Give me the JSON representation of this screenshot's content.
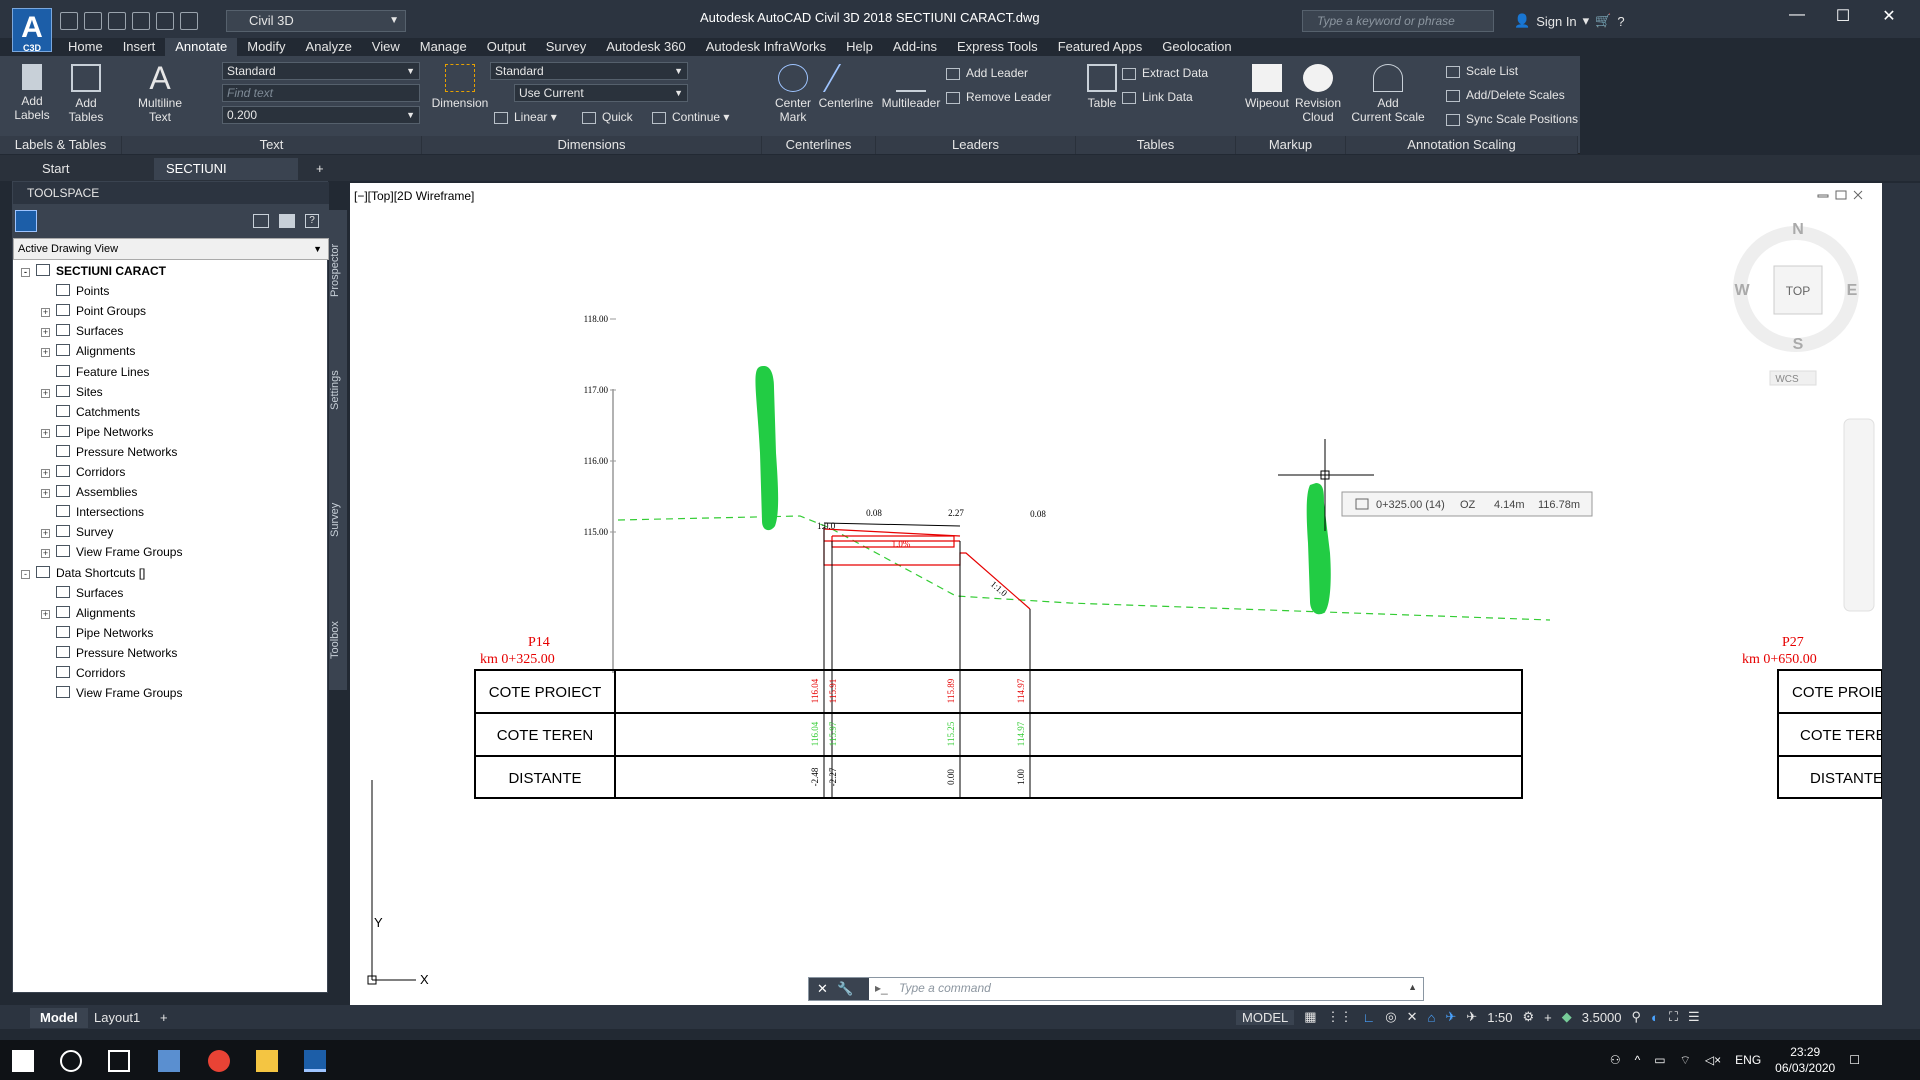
{
  "window": {
    "title": "Autodesk AutoCAD Civil 3D 2018    SECTIUNI CARACT.dwg",
    "workspace": "Civil 3D",
    "search_placeholder": "Type a keyword or phrase",
    "sign_in": "Sign In",
    "logo_text": "A",
    "logo_sub": "C3D"
  },
  "ribbon_tabs": [
    "Home",
    "Insert",
    "Annotate",
    "Modify",
    "Analyze",
    "View",
    "Manage",
    "Output",
    "Survey",
    "Autodesk 360",
    "Autodesk InfraWorks",
    "Help",
    "Add-ins",
    "Express Tools",
    "Featured Apps",
    "Geolocation"
  ],
  "ribbon_active_tab": "Annotate",
  "ribbon": {
    "labels_tables": {
      "title": "Labels & Tables",
      "add_labels": "Add\nLabels",
      "add_tables": "Add\nTables"
    },
    "text": {
      "title": "Text",
      "multiline_text": "Multiline\nText",
      "style_value": "Standard",
      "find_placeholder": "Find text",
      "height_value": "0.200"
    },
    "dimensions": {
      "title": "Dimensions",
      "dimension": "Dimension",
      "style_value": "Standard",
      "layer_value": "Use Current",
      "linear": "Linear",
      "quick": "Quick",
      "continue": "Continue"
    },
    "centerlines": {
      "title": "Centerlines",
      "center_mark": "Center\nMark",
      "centerline": "Centerline"
    },
    "leaders": {
      "title": "Leaders",
      "multileader": "Multileader",
      "add_leader": "Add Leader",
      "remove_leader": "Remove Leader"
    },
    "tables": {
      "title": "Tables",
      "table": "Table",
      "extract_data": "Extract Data",
      "link_data": "Link Data"
    },
    "markup": {
      "title": "Markup",
      "wipeout": "Wipeout",
      "revision_cloud": "Revision\nCloud"
    },
    "annotation_scaling": {
      "title": "Annotation Scaling",
      "add_current_scale": "Add\nCurrent Scale",
      "scale_list": "Scale List",
      "add_delete_scales": "Add/Delete Scales",
      "sync_scale_positions": "Sync Scale Positions"
    }
  },
  "doc_tabs": [
    "Start",
    "SECTIUNI CARACT*"
  ],
  "toolspace": {
    "header": "TOOLSPACE",
    "view_select": "Active Drawing View",
    "side_tabs": [
      "Prospector",
      "Settings",
      "Survey",
      "Toolbox"
    ],
    "tree": [
      {
        "label": "SECTIUNI CARACT",
        "level": 0,
        "expander": "-",
        "bold": true
      },
      {
        "label": "Points",
        "level": 1,
        "expander": ""
      },
      {
        "label": "Point Groups",
        "level": 1,
        "expander": "+"
      },
      {
        "label": "Surfaces",
        "level": 1,
        "expander": "+"
      },
      {
        "label": "Alignments",
        "level": 1,
        "expander": "+"
      },
      {
        "label": "Feature Lines",
        "level": 1,
        "expander": ""
      },
      {
        "label": "Sites",
        "level": 1,
        "expander": "+"
      },
      {
        "label": "Catchments",
        "level": 1,
        "expander": ""
      },
      {
        "label": "Pipe Networks",
        "level": 1,
        "expander": "+"
      },
      {
        "label": "Pressure Networks",
        "level": 1,
        "expander": ""
      },
      {
        "label": "Corridors",
        "level": 1,
        "expander": "+"
      },
      {
        "label": "Assemblies",
        "level": 1,
        "expander": "+"
      },
      {
        "label": "Intersections",
        "level": 1,
        "expander": ""
      },
      {
        "label": "Survey",
        "level": 1,
        "expander": "+"
      },
      {
        "label": "View Frame Groups",
        "level": 1,
        "expander": "+"
      },
      {
        "label": "Data Shortcuts []",
        "level": 0,
        "expander": "-"
      },
      {
        "label": "Surfaces",
        "level": 1,
        "expander": ""
      },
      {
        "label": "Alignments",
        "level": 1,
        "expander": "+"
      },
      {
        "label": "Pipe Networks",
        "level": 1,
        "expander": ""
      },
      {
        "label": "Pressure Networks",
        "level": 1,
        "expander": ""
      },
      {
        "label": "Corridors",
        "level": 1,
        "expander": ""
      },
      {
        "label": "View Frame Groups",
        "level": 1,
        "expander": ""
      }
    ]
  },
  "viewport": {
    "label": "[−][Top][2D Wireframe]",
    "viewcube": {
      "top": "TOP",
      "n": "N",
      "s": "S",
      "e": "E",
      "w": "W",
      "wcs": "WCS"
    },
    "ucs": {
      "x": "X",
      "y": "Y"
    }
  },
  "section": {
    "elevation_ticks": [
      "118.00",
      "117.00",
      "116.00",
      "115.00"
    ],
    "left_label": {
      "name": "P14",
      "km": "km 0+325.00"
    },
    "right_label": {
      "name": "P27",
      "km": "km 0+650.00"
    },
    "dims_top": [
      "0.08",
      "2.27",
      "0.08"
    ],
    "slope_left": "1:0.0",
    "slope_right": "1:1.0",
    "grade": "1.0%",
    "tooltip": {
      "station": "0+325.00 (14)",
      "label": "OZ",
      "offset": "4.14m",
      "elevation": "116.78m"
    },
    "rows": [
      "COTE PROIECT",
      "COTE TEREN",
      "DISTANTE"
    ],
    "cote_proiect": [
      "116.04",
      "115.91",
      "115.89",
      "114.97"
    ],
    "cote_teren": [
      "116.04",
      "115.97",
      "115.25",
      "114.97"
    ],
    "distante": [
      "-2.48",
      "-2.27",
      "0.00",
      "1.00"
    ],
    "right_rows": [
      "COTE PROIE",
      "COTE TERE",
      "DISTANTE"
    ]
  },
  "command_line": {
    "placeholder": "Type a command"
  },
  "layout_tabs": [
    "Model",
    "Layout1"
  ],
  "status": {
    "model": "MODEL",
    "scale": "1:50",
    "value": "3.5000"
  },
  "taskbar": {
    "time": "23:29",
    "date": "06/03/2020",
    "lang": "ENG"
  },
  "colors": {
    "accent": "#1c5ea8",
    "green_blob": "#22cc44",
    "design_line": "#e60000",
    "ground_line": "#33cc33"
  }
}
